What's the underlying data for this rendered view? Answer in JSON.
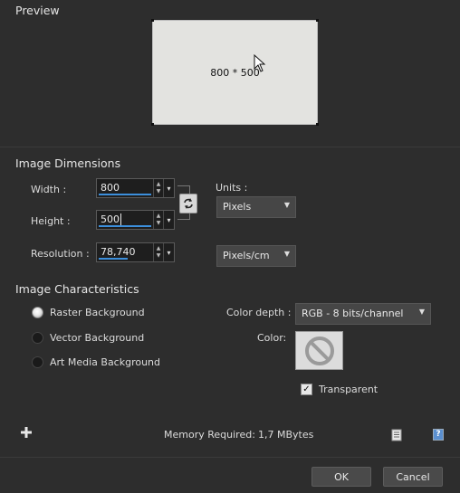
{
  "preview": {
    "title": "Preview",
    "dimension_text": "800 * 500"
  },
  "dimensions": {
    "title": "Image Dimensions",
    "width_label": "Width :",
    "width_value": "800",
    "height_label": "Height :",
    "height_value": "500",
    "resolution_label": "Resolution :",
    "resolution_value": "78,740",
    "units_label": "Units :",
    "units_value": "Pixels",
    "resolution_units_value": "Pixels/cm"
  },
  "characteristics": {
    "title": "Image Characteristics",
    "options": [
      {
        "label": "Raster Background",
        "checked": true
      },
      {
        "label": "Vector Background",
        "checked": false
      },
      {
        "label": "Art Media Background",
        "checked": false
      }
    ],
    "color_depth_label": "Color depth :",
    "color_depth_value": "RGB - 8 bits/channel",
    "color_label": "Color:",
    "transparent_label": "Transparent",
    "transparent_checked": true
  },
  "footer": {
    "memory_label": "Memory Required:",
    "memory_value": "1,7 MBytes",
    "ok_label": "OK",
    "cancel_label": "Cancel"
  },
  "colors": {
    "background": "#2d2d2d",
    "accent": "#3c8fdc",
    "preview_fill": "#e3e3e0"
  },
  "icons": [
    "cursor-icon",
    "swap-icon",
    "no-color-icon",
    "add-icon",
    "clipboard-icon",
    "help-icon"
  ]
}
